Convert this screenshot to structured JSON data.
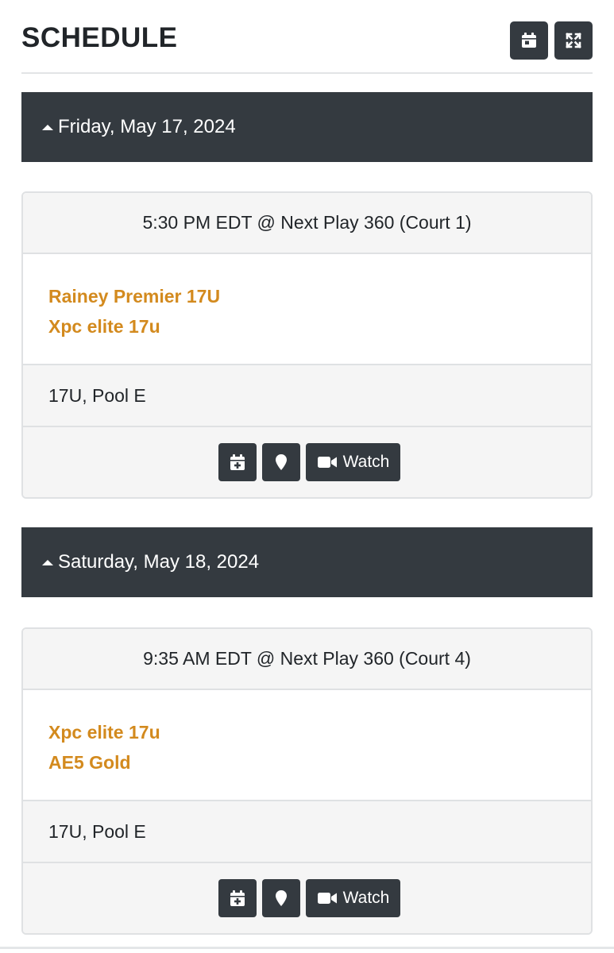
{
  "header": {
    "title": "SCHEDULE",
    "calendar_icon": "calendar-icon",
    "expand_icon": "expand-icon"
  },
  "days": [
    {
      "label": "Friday, May 17, 2024",
      "games": [
        {
          "time_location": "5:30 PM EDT @ Next Play 360 (Court 1)",
          "teams": [
            "Rainey Premier 17U",
            "Xpc elite 17u"
          ],
          "pool": "17U, Pool E",
          "watch_label": "Watch"
        }
      ]
    },
    {
      "label": "Saturday, May 18, 2024",
      "games": [
        {
          "time_location": "9:35 AM EDT @ Next Play 360 (Court 4)",
          "teams": [
            "Xpc elite 17u",
            "AE5 Gold"
          ],
          "pool": "17U, Pool E",
          "watch_label": "Watch"
        }
      ]
    }
  ],
  "colors": {
    "dark": "#343a40",
    "team_link": "#d38a1e",
    "panel": "#f5f5f5"
  }
}
